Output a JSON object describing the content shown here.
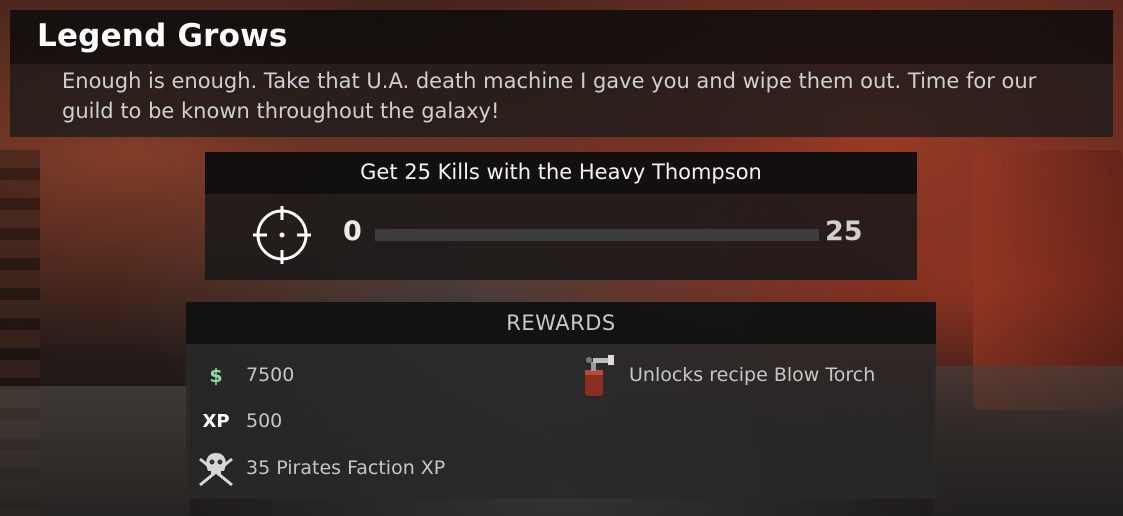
{
  "quest": {
    "title": "Legend Grows",
    "description": "Enough is enough. Take that U.A. death machine I gave you and wipe them out. Time for our guild to be known throughout the galaxy!"
  },
  "objective": {
    "title": "Get 25 Kills with the Heavy Thompson",
    "icon": "crosshair-icon",
    "progress_start": "0",
    "progress_end": "25",
    "progress_fraction": 0
  },
  "rewards": {
    "header": "REWARDS",
    "money": {
      "icon": "dollar-icon",
      "symbol": "$",
      "value": "7500",
      "color": "#8fd9a6"
    },
    "xp": {
      "icon": "xp-icon",
      "label": "XP",
      "value": "500"
    },
    "faction": {
      "icon": "pirate-skull-icon",
      "value": "35 Pirates Faction XP"
    },
    "recipe": {
      "icon": "blow-torch-icon",
      "value": "Unlocks recipe Blow Torch"
    }
  }
}
